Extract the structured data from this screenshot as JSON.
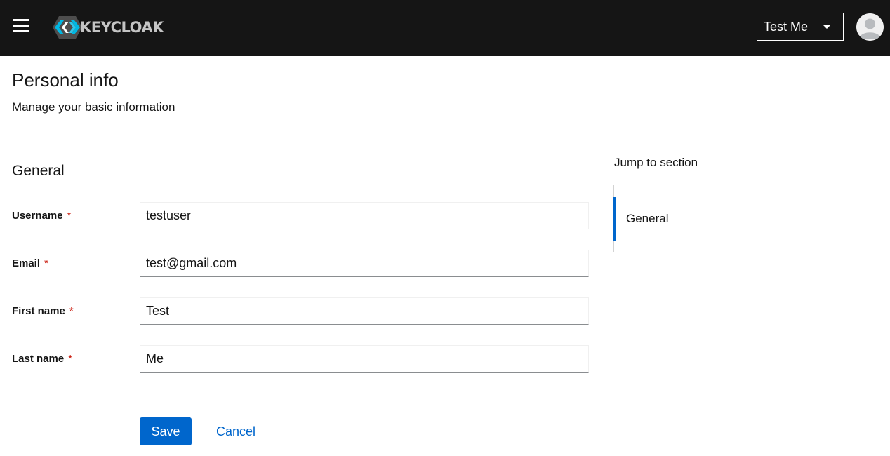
{
  "header": {
    "brand_text": "KEYCLOAK",
    "menu_icon": "hamburger-menu-icon",
    "user_name": "Test Me",
    "dropdown_icon": "caret-down-icon",
    "avatar_icon": "user-avatar-icon"
  },
  "page": {
    "title": "Personal info",
    "subtitle": "Manage your basic information"
  },
  "section": {
    "title": "General"
  },
  "form": {
    "required_marker": "*",
    "fields": [
      {
        "label": "Username",
        "value": "testuser"
      },
      {
        "label": "Email",
        "value": "test@gmail.com"
      },
      {
        "label": "First name",
        "value": "Test"
      },
      {
        "label": "Last name",
        "value": "Me"
      }
    ],
    "save_label": "Save",
    "cancel_label": "Cancel"
  },
  "jump_links": {
    "title": "Jump to section",
    "items": [
      {
        "label": "General",
        "active": true
      }
    ]
  },
  "colors": {
    "masthead": "#151515",
    "primary": "#0066cc",
    "required": "#c9190b",
    "logo_blue": "#00b8e3"
  }
}
